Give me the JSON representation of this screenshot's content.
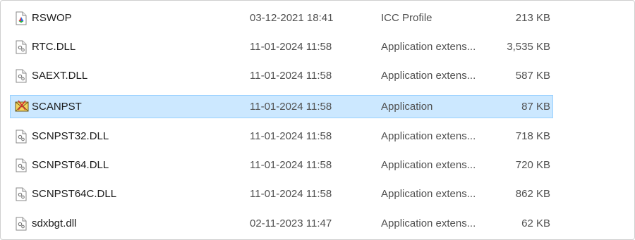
{
  "files": [
    {
      "name": "RSWOP",
      "date": "03-12-2021 18:41",
      "type": "ICC Profile",
      "size": "213 KB",
      "icon": "icc-profile-icon"
    },
    {
      "name": "RTC.DLL",
      "date": "11-01-2024 11:58",
      "type": "Application extens...",
      "size": "3,535 KB",
      "icon": "dll-file-icon"
    },
    {
      "name": "SAEXT.DLL",
      "date": "11-01-2024 11:58",
      "type": "Application extens...",
      "size": "587 KB",
      "icon": "dll-file-icon"
    },
    {
      "name": "SCANPST",
      "date": "11-01-2024 11:58",
      "type": "Application",
      "size": "87 KB",
      "icon": "scanpst-app-icon",
      "selected": true
    },
    {
      "name": "SCNPST32.DLL",
      "date": "11-01-2024 11:58",
      "type": "Application extens...",
      "size": "718 KB",
      "icon": "dll-file-icon"
    },
    {
      "name": "SCNPST64.DLL",
      "date": "11-01-2024 11:58",
      "type": "Application extens...",
      "size": "720 KB",
      "icon": "dll-file-icon"
    },
    {
      "name": "SCNPST64C.DLL",
      "date": "11-01-2024 11:58",
      "type": "Application extens...",
      "size": "862 KB",
      "icon": "dll-file-icon"
    },
    {
      "name": "sdxbgt.dll",
      "date": "02-11-2023 11:47",
      "type": "Application extens...",
      "size": "62 KB",
      "icon": "dll-file-icon"
    }
  ],
  "colors": {
    "selection_bg": "#cce8ff",
    "selection_border": "#99d1ff",
    "name_text": "#1a1a1a",
    "detail_text": "#505050"
  }
}
